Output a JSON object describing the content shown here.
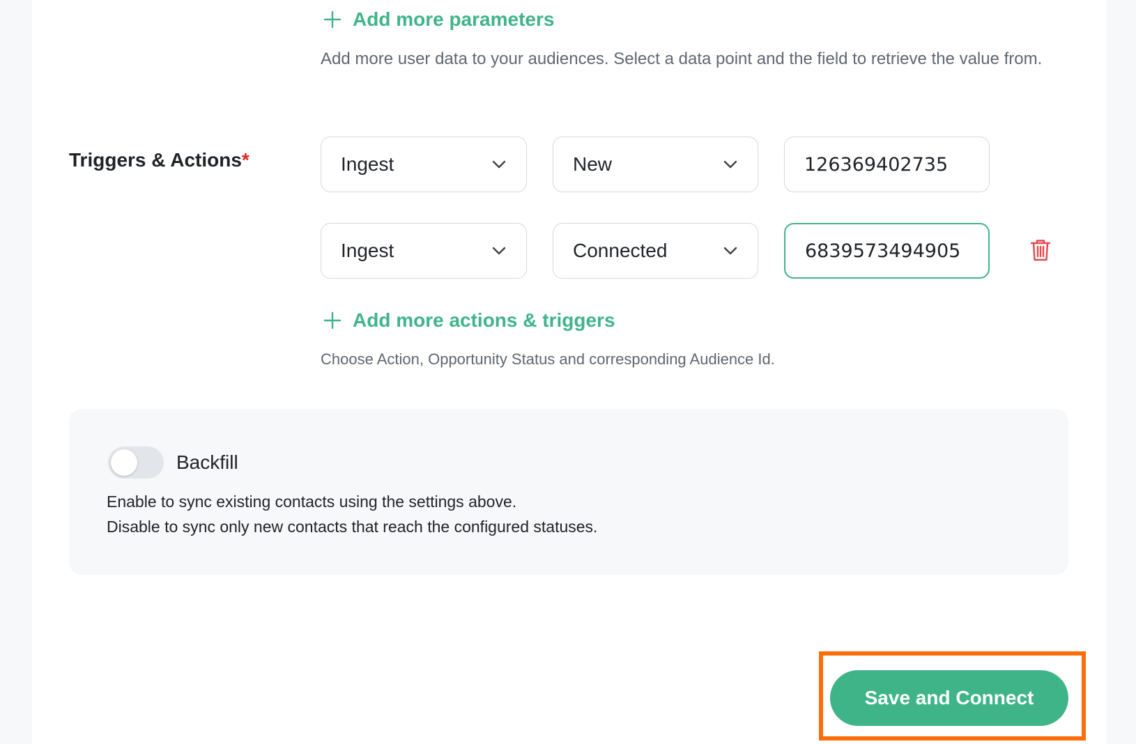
{
  "parameters": {
    "add_label": "Add more parameters",
    "helper": "Add more user data to your audiences. Select a data point and the field to retrieve the value from."
  },
  "triggers": {
    "label": "Triggers & Actions",
    "required_mark": "*",
    "rows": [
      {
        "action": "Ingest",
        "status": "New",
        "audience_id": "126369402735"
      },
      {
        "action": "Ingest",
        "status": "Connected",
        "audience_id": "6839573494905"
      }
    ],
    "add_label": "Add more actions & triggers",
    "helper": "Choose Action, Opportunity Status and corresponding Audience Id."
  },
  "backfill": {
    "label": "Backfill",
    "enabled": false,
    "line1": "Enable to sync existing contacts using the settings above.",
    "line2": "Disable to sync only new contacts that reach the configured statuses."
  },
  "save_button": {
    "label": "Save and Connect"
  },
  "colors": {
    "accent": "#3fb489",
    "required": "#e02424",
    "delete": "#e5484d",
    "highlight": "#ff6d0a"
  }
}
